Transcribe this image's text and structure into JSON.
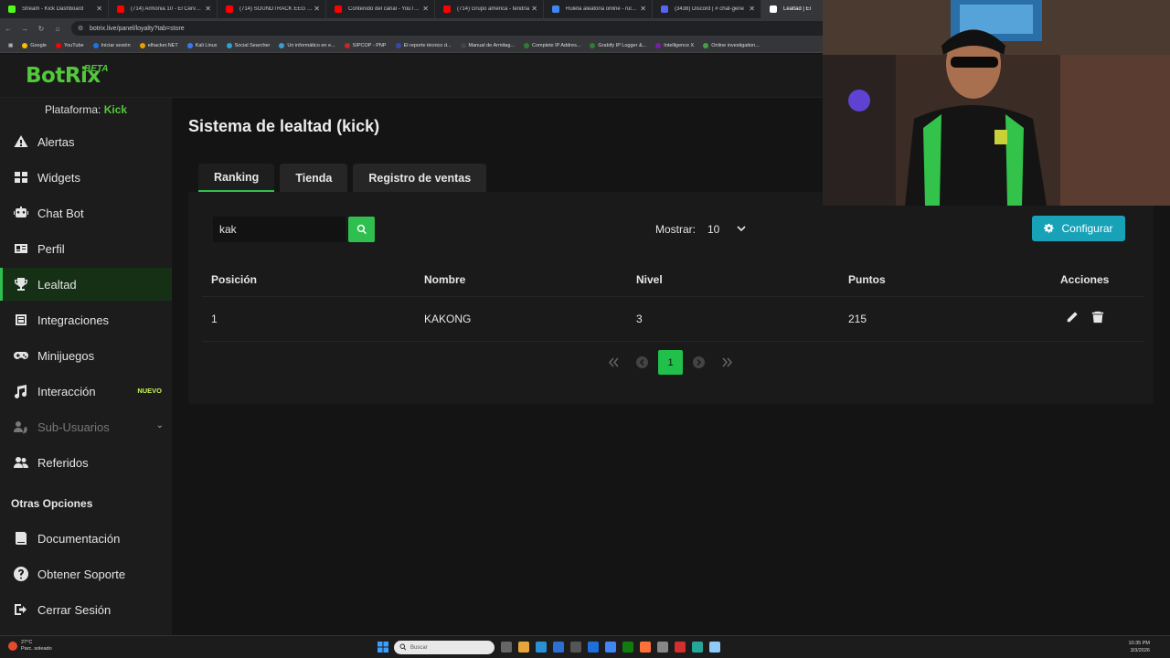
{
  "browser": {
    "tabs": [
      {
        "title": "Stream - Kick Dashboard",
        "color": "#53fc18",
        "active": false
      },
      {
        "title": "(714) Armonia 10 - El Cervecero",
        "color": "#ff0000",
        "active": false
      },
      {
        "title": "(714) SOUNDTRACK EEG | S",
        "color": "#ff0000",
        "active": false
      },
      {
        "title": "Contenido del canal - YouTube",
        "color": "#ff0000",
        "active": false
      },
      {
        "title": "(714) Grupo america - tendria",
        "color": "#ff0000",
        "active": false
      },
      {
        "title": "Ruleta aleatoria online - ruleta",
        "color": "#4285f4",
        "active": false
      },
      {
        "title": "(3438) Discord | # chat-gene",
        "color": "#5865f2",
        "active": false
      },
      {
        "title": "Lealtad | El",
        "color": "#ffffff",
        "active": true
      }
    ],
    "url": "botrix.live/panel/loyalty?tab=store",
    "bookmarks": [
      {
        "label": "Google",
        "color": "#fbbc05"
      },
      {
        "label": "YouTube",
        "color": "#ff0000"
      },
      {
        "label": "Iniciar sesión",
        "color": "#1a73e8"
      },
      {
        "label": "elhacker.NET",
        "color": "#e8a000"
      },
      {
        "label": "Kali Linux",
        "color": "#367bf0"
      },
      {
        "label": "Social Searcher",
        "color": "#2aa3d8"
      },
      {
        "label": "Un informático en e...",
        "color": "#35a0d0"
      },
      {
        "label": "SIPCOP - PNP",
        "color": "#c62828"
      },
      {
        "label": "El reporte técnico d...",
        "color": "#3949ab"
      },
      {
        "label": "Manual de Armitag...",
        "color": "#444444"
      },
      {
        "label": "Complete IP Addres...",
        "color": "#2e7d32"
      },
      {
        "label": "Grabify IP Logger &...",
        "color": "#2e7d32"
      },
      {
        "label": "Intelligence X",
        "color": "#7b1fa2"
      },
      {
        "label": "Online investigation...",
        "color": "#43a047"
      }
    ]
  },
  "app": {
    "logo": "BotRix",
    "logo_badge": "BETA",
    "platform_label": "Plataforma:",
    "platform_value": "Kick",
    "accent": "#2fbf4f",
    "nav": [
      {
        "label": "Alertas",
        "icon": "warning-icon"
      },
      {
        "label": "Widgets",
        "icon": "grid-icon"
      },
      {
        "label": "Chat Bot",
        "icon": "robot-icon"
      },
      {
        "label": "Perfil",
        "icon": "id-card-icon"
      },
      {
        "label": "Lealtad",
        "icon": "trophy-icon",
        "active": true
      },
      {
        "label": "Integraciones",
        "icon": "integrations-icon"
      },
      {
        "label": "Minijuegos",
        "icon": "gamepad-icon"
      },
      {
        "label": "Interacción",
        "icon": "music-icon",
        "badge": "NUEVO"
      },
      {
        "label": "Sub-Usuarios",
        "icon": "users-cog-icon",
        "disabled": true
      },
      {
        "label": "Referidos",
        "icon": "users-icon"
      }
    ],
    "other_title": "Otras Opciones",
    "other": [
      {
        "label": "Documentación",
        "icon": "book-icon"
      },
      {
        "label": "Obtener Soporte",
        "icon": "question-icon"
      },
      {
        "label": "Cerrar Sesión",
        "icon": "logout-icon"
      }
    ]
  },
  "main": {
    "title": "Sistema de lealtad (kick)",
    "tabs": [
      "Ranking",
      "Tienda",
      "Registro de ventas"
    ],
    "search_value": "kak",
    "show_label": "Mostrar:",
    "show_value": "10",
    "config_label": "Configurar",
    "columns": [
      "Posición",
      "Nombre",
      "Nivel",
      "Puntos",
      "Acciones"
    ],
    "rows": [
      {
        "position": "1",
        "name": "KAKONG",
        "level": "3",
        "points": "215"
      }
    ],
    "current_page": "1"
  },
  "taskbar": {
    "temp": "27°C",
    "weather": "Parc. soleado",
    "search_placeholder": "Buscar",
    "time": "10:35 PM",
    "date": "3/3/2026"
  }
}
